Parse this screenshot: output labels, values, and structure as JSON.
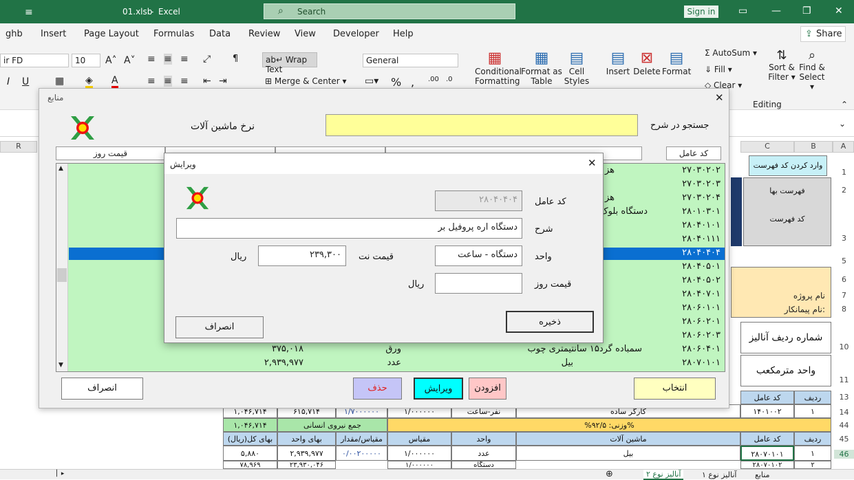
{
  "titlebar": {
    "filename": "01.xlsb",
    "sep": "-",
    "app": "Excel",
    "search_placeholder": "Search",
    "signin": "Sign in"
  },
  "menu": {
    "items": [
      "ghb",
      "Insert",
      "Page Layout",
      "Formulas",
      "Data",
      "Review",
      "View",
      "Developer",
      "Help"
    ],
    "share": "Share"
  },
  "ribbon": {
    "font_name": "ir FD",
    "font_size": "10",
    "wrap_text": "Wrap Text",
    "merge_center": "Merge & Center",
    "number_format": "General",
    "conditional": "Conditional",
    "conditional2": "Formatting",
    "format_as": "Format as",
    "format_as2": "Table",
    "cell": "Cell",
    "cell2": "Styles",
    "insert": "Insert",
    "delete": "Delete",
    "format": "Format",
    "autosum": "AutoSum",
    "fill": "Fill",
    "clear": "Clear",
    "sort": "Sort &",
    "sort2": "Filter",
    "find": "Find &",
    "find2": "Select",
    "editing": "Editing"
  },
  "columns": {
    "r": "R",
    "c": "C",
    "b": "B",
    "a": "A"
  },
  "rows": [
    "1",
    "2",
    "3",
    "5",
    "6",
    "7",
    "8",
    "10",
    "11",
    "13",
    "14",
    "44",
    "45",
    "46"
  ],
  "sheet_bg": {
    "btn_enter_code": "وارد کردن کد فهرست",
    "price_list": "فهرست بها",
    "list_code": "کد فهرست",
    "project_name": "نام پروژه",
    "contractor": "نام پیمانکار:",
    "analysis_row": "شماره ردیف آنالیز",
    "unit": "واحد  مترمکعب",
    "h_row": "ردیف",
    "h_code": "کد عامل",
    "r14_row": "۱",
    "r14_code": "۱۴۰۱۰۰۲",
    "r14_desc": "کارگر ساده",
    "r14_unit": "نفر-ساعت",
    "r14_scale": "۱/۰۰۰۰۰۰",
    "r14_qty": "۱/۷۰۰۰۰۰۰",
    "r14_price": "۶۱۵,۷۱۴",
    "r14_total": "۱,۰۴۶,۷۱۴",
    "weight": "%وزنی: ۹۲/۵%",
    "labor_sum": "جمع  نیروی انسانی",
    "labor_total": "۱,۰۴۶,۷۱۴",
    "h45_row": "ردیف",
    "h45_code": "کد عامل",
    "h45_mach": "ماشین  آلات",
    "h45_unit": "واحد",
    "h45_scale": "مقیاس",
    "h45_qty": "مقیاس/مقدار",
    "h45_price": "بهای واحد",
    "h45_total": "بهای کل(ریال)",
    "r46_row": "۱",
    "r46_code": "۲۸۰۷۰۱۰۱",
    "r46_desc": "بیل",
    "r46_unit": "عدد",
    "r46_scale": "۱/۰۰۰۰۰۰",
    "r46_qty": "۰/۰۰۲۰۰۰۰۰",
    "r46_price": "۲,۹۳۹,۹۷۷",
    "r46_total": "۵,۸۸۰",
    "r47_row": "۲",
    "r47_code": "۲۸۰۷۰۱۰۲",
    "r47_unit": "دستگاه",
    "r47_scale": "۱/۰۰۰۰۰۰",
    "r47_price": "۲۳,۹۳۰,۰۴۶",
    "r47_total": "۷۸,۹۶۹"
  },
  "tabs": [
    "منابع",
    "آنالیز نوع ۱",
    "آنالیز نوع ۲"
  ],
  "main_dialog": {
    "title": "منابع",
    "heading": "نرخ ماشین آلات",
    "search_label": "جستجو در شرح",
    "search_value": "",
    "col_code": "کد عامل",
    "col_price": "قیمت روز",
    "rows": [
      {
        "code": "۲۷۰۳۰۲۰۲",
        "desc": "هز",
        "unit": "",
        "price": ""
      },
      {
        "code": "۲۷۰۳۰۲۰۳",
        "desc": "",
        "unit": "",
        "price": ""
      },
      {
        "code": "۲۷۰۳۰۲۰۴",
        "desc": "هز",
        "unit": "",
        "price": ""
      },
      {
        "code": "۲۸۰۱۰۳۰۱",
        "desc": "دستگاه بلوک",
        "unit": "",
        "price": ""
      },
      {
        "code": "۲۸۰۴۰۱۰۱",
        "desc": "",
        "unit": "",
        "price": ""
      },
      {
        "code": "۲۸۰۴۰۱۱۱",
        "desc": "",
        "unit": "",
        "price": ""
      },
      {
        "code": "۲۸۰۴۰۴۰۴",
        "desc": "",
        "unit": "",
        "price": ""
      },
      {
        "code": "۲۸۰۴۰۵۰۱",
        "desc": "",
        "unit": "",
        "price": ""
      },
      {
        "code": "۲۸۰۴۰۵۰۲",
        "desc": "",
        "unit": "",
        "price": ""
      },
      {
        "code": "۲۸۰۴۰۷۰۱",
        "desc": "",
        "unit": "",
        "price": ""
      },
      {
        "code": "۲۸۰۶۰۱۰۱",
        "desc": "",
        "unit": "",
        "price": ""
      },
      {
        "code": "۲۸۰۶۰۲۰۱",
        "desc": "",
        "unit": "",
        "price": ""
      },
      {
        "code": "۲۸۰۶۰۲۰۳",
        "desc": "",
        "unit": "",
        "price": ""
      },
      {
        "code": "۲۸۰۶۰۴۰۱",
        "desc": "سمباده گرد۱۵ سانتیمتری چوب",
        "unit": "ورق",
        "price": "۳۷۵,۰۱۸"
      },
      {
        "code": "۲۸۰۷۰۱۰۱",
        "desc": "بیل",
        "unit": "عدد",
        "price": "۲,۹۳۹,۹۷۷"
      }
    ],
    "btn_select": "انتخاب",
    "btn_add": "افزودن",
    "btn_edit": "ویرایش",
    "btn_delete": "حذف",
    "btn_cancel": "انصراف"
  },
  "edit_dialog": {
    "title": "ویرایش",
    "code_label": "کد عامل",
    "code_value": "۲۸۰۴۰۴۰۴",
    "desc_label": "شرح",
    "desc_value": "دستگاه اره پروفیل بر",
    "unit_label": "واحد",
    "unit_value": "دستگاه  -  ساعت",
    "net_price_label": "قیمت نت",
    "net_price_value": "۲۳۹,۳۰۰",
    "rial1": "ریال",
    "day_price_label": "قیمت روز",
    "day_price_value": "",
    "rial2": "ریال",
    "btn_save": "ذخیره",
    "btn_cancel": "انصراف"
  },
  "colors": {
    "excel_green": "#217346",
    "list_green": "#c0f5c0",
    "selected": "#0a6fd1",
    "yellow": "#ffff99"
  }
}
